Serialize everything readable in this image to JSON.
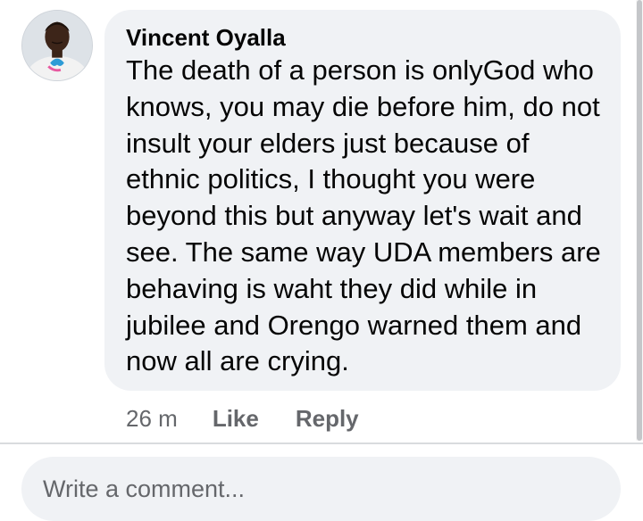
{
  "comment": {
    "author": "Vincent Oyalla",
    "text": "The death of a person is onlyGod who knows, you may die before him, do not insult your elders just because of ethnic politics, I thought you were beyond this but anyway let's wait and see. The same way UDA members are behaving is waht they did while in jubilee and Orengo warned them and now all are crying.",
    "timestamp": "26 m",
    "like_label": "Like",
    "reply_label": "Reply"
  },
  "composer": {
    "placeholder": "Write a comment..."
  },
  "colors": {
    "bubble": "#f0f2f5",
    "secondary_text": "#65676b",
    "primary_text": "#050505"
  }
}
